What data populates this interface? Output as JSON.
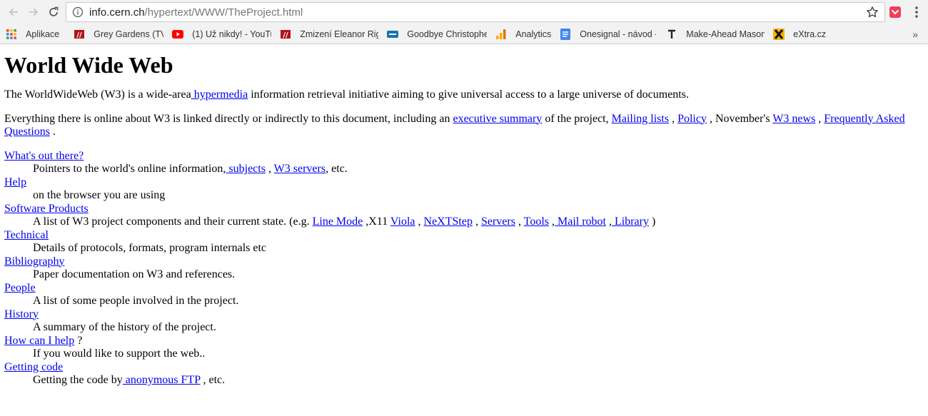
{
  "browser": {
    "url_host": "info.cern.ch",
    "url_path": "/hypertext/WWW/TheProject.html",
    "bookmarks": [
      {
        "label": "Aplikace",
        "icon": "apps-grid-icon",
        "color": "#e8453c"
      },
      {
        "label": "Grey Gardens (TV fil",
        "icon": "csfd-icon",
        "color": "#b5121b"
      },
      {
        "label": "(1) Už nikdy! - YouTu",
        "icon": "youtube-icon",
        "color": "#ff0000"
      },
      {
        "label": "Zmizení Eleanor Rigl",
        "icon": "csfd-icon",
        "color": "#b5121b"
      },
      {
        "label": "Goodbye Christophe",
        "icon": "film-icon",
        "color": "#1a73a8"
      },
      {
        "label": "Analytics",
        "icon": "analytics-icon",
        "color": "#f9ab00"
      },
      {
        "label": "Onesignal - návod -",
        "icon": "docs-icon",
        "color": "#4285f4"
      },
      {
        "label": "Make-Ahead Mason",
        "icon": "t-icon",
        "color": "#222222"
      },
      {
        "label": "eXtra.cz",
        "icon": "extra-x-icon",
        "color": "#f5b400"
      }
    ],
    "more_label": "»"
  },
  "page": {
    "title": "World Wide Web",
    "intro": {
      "t1": "The WorldWideWeb (W3) is a wide-area",
      "link_hypermedia": " hypermedia",
      "t2": " information retrieval initiative aiming to give universal access to a large universe of documents."
    },
    "everything": {
      "t1": "Everything there is online about W3 is linked directly or indirectly to this document, including an ",
      "link_exec": "executive summary",
      "t2": " of the project, ",
      "link_mailing": "Mailing lists",
      "t3": " , ",
      "link_policy": "Policy",
      "t4": " , November's ",
      "link_news": "W3 news",
      "t5": " , ",
      "link_faq": "Frequently Asked Questions",
      "t6": " ."
    },
    "sections": {
      "whats_out": {
        "title": "What's out there?",
        "d1": "Pointers to the world's online information,",
        "link_subjects": " subjects",
        "d2": " , ",
        "link_servers": "W3 servers",
        "d3": ", etc."
      },
      "help": {
        "title": "Help",
        "desc": "on the browser you are using"
      },
      "software": {
        "title": "Software Products",
        "d1": "A list of W3 project components and their current state. (e.g. ",
        "link_linemode": "Line Mode",
        "d2": " ,X11 ",
        "link_viola": "Viola",
        "d3": " , ",
        "link_nextstep": "NeXTStep",
        "d4": " , ",
        "link_servers": "Servers",
        "d5": " , ",
        "link_tools": "Tools",
        "d6": " ,",
        "link_mailrobot": " Mail robot",
        "d7": " ,",
        "link_library": " Library",
        "d8": " )"
      },
      "technical": {
        "title": "Technical",
        "desc": "Details of protocols, formats, program internals etc"
      },
      "bibliography": {
        "title": "Bibliography",
        "desc": "Paper documentation on W3 and references."
      },
      "people": {
        "title": "People",
        "desc": "A list of some people involved in the project."
      },
      "history": {
        "title": "History",
        "desc": "A summary of the history of the project."
      },
      "howhelp": {
        "title": "How can I help",
        "suffix": " ?",
        "desc": "If you would like to support the web.."
      },
      "gettingcode": {
        "title": "Getting code",
        "d1": "Getting the code by",
        "link_ftp": " anonymous FTP",
        "d2": " , etc."
      }
    }
  }
}
